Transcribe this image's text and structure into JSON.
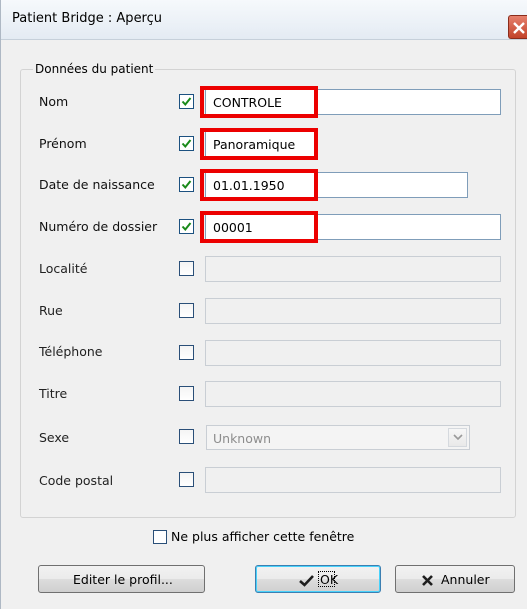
{
  "window": {
    "title": "Patient Bridge : Aperçu"
  },
  "group": {
    "title": "Données du patient"
  },
  "fields": [
    {
      "label": "Nom",
      "checked": true,
      "value": "CONTROLE",
      "enabled": true,
      "highlighted": true
    },
    {
      "label": "Prénom",
      "checked": true,
      "value": "Panoramique",
      "enabled": true,
      "highlighted": true
    },
    {
      "label": "Date de naissance",
      "checked": true,
      "value": "01.01.1950",
      "enabled": true,
      "highlighted": true
    },
    {
      "label": "Numéro de dossier",
      "checked": true,
      "value": "00001",
      "enabled": true,
      "highlighted": true
    },
    {
      "label": "Localité",
      "checked": false,
      "value": "",
      "enabled": false
    },
    {
      "label": "Rue",
      "checked": false,
      "value": "",
      "enabled": false
    },
    {
      "label": "Téléphone",
      "checked": false,
      "value": "",
      "enabled": false
    },
    {
      "label": "Titre",
      "checked": false,
      "value": "",
      "enabled": false
    },
    {
      "label": "Sexe",
      "checked": false,
      "value": "Unknown",
      "enabled": false
    },
    {
      "label": "Code postal",
      "checked": false,
      "value": "",
      "enabled": false
    }
  ],
  "dont_show": {
    "label": "Ne plus afficher cette fenêtre",
    "checked": false
  },
  "buttons": {
    "edit_profile": "Editer le profil...",
    "ok": "OK",
    "cancel": "Annuler"
  },
  "colors": {
    "highlight_border": "#ec0000",
    "checkmark": "#1a8a1a"
  }
}
